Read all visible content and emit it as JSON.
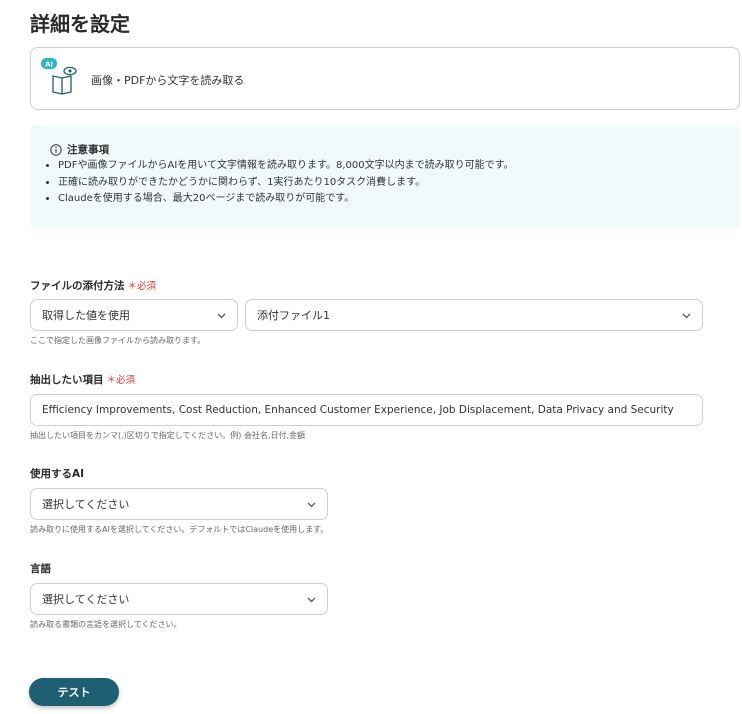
{
  "page": {
    "title": "詳細を設定"
  },
  "action": {
    "label": "画像・PDFから文字を読み取る",
    "badge": "AI"
  },
  "notice": {
    "title": "注意事項",
    "items": [
      "PDFや画像ファイルからAIを用いて文字情報を読み取ります。8,000文字以内まで読み取り可能です。",
      "正確に読み取りができたかどうかに関わらず、1実行あたり10タスク消費します。",
      "Claudeを使用する場合、最大20ページまで読み取りが可能です。"
    ]
  },
  "fields": {
    "attachment": {
      "label": "ファイルの添付方法",
      "required": "＊必須",
      "method_value": "取得した値を使用",
      "file_value": "添付ファイル1",
      "hint": "ここで指定した画像ファイルから読み取ります。"
    },
    "extract": {
      "label": "抽出したい項目",
      "required": "＊必須",
      "value": "Efficiency Improvements, Cost Reduction, Enhanced Customer Experience, Job Displacement, Data Privacy and Security",
      "hint": "抽出したい項目をカンマ(,)区切りで指定してください。例) 会社名,日付,金額"
    },
    "ai": {
      "label": "使用するAI",
      "value": "選択してください",
      "hint": "読み取りに使用するAIを選択してください。デフォルトではClaudeを使用します。"
    },
    "language": {
      "label": "言語",
      "value": "選択してください",
      "hint": "読み取る書類の言語を選択してください。"
    }
  },
  "buttons": {
    "test": "テスト"
  },
  "colors": {
    "accent": "#1f5f73",
    "required": "#e0343a",
    "notice_bg": "#f1fafa",
    "badge": "#2cb5c8"
  }
}
